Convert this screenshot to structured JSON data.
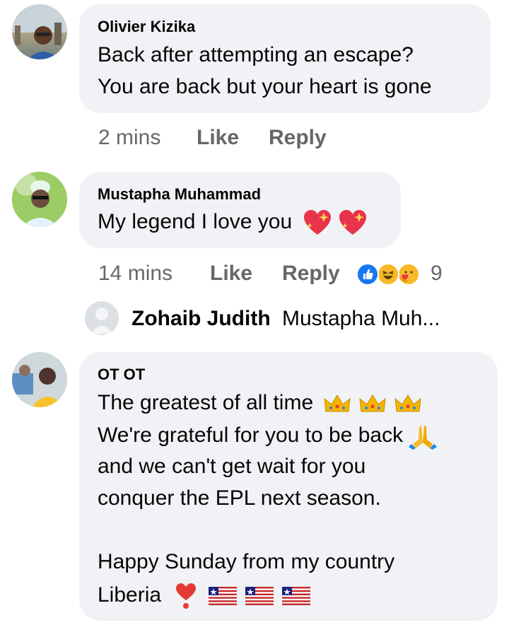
{
  "comments": [
    {
      "author": "Olivier Kizika",
      "lines": [
        "Back after attempting an escape?",
        "You are back but your heart is gone"
      ],
      "time": "2 mins",
      "like_label": "Like",
      "reply_label": "Reply"
    },
    {
      "author": "Mustapha Muhammad",
      "lines": [
        "My legend I love you"
      ],
      "time": "14 mins",
      "like_label": "Like",
      "reply_label": "Reply",
      "reaction_count": "9",
      "reactions": [
        "like-icon",
        "laughing-icon",
        "care-icon"
      ],
      "reply_preview": {
        "author": "Zohaib Judith",
        "text": "Mustapha Muh..."
      }
    },
    {
      "author": "OT OT",
      "lines": [
        "The greatest of all time",
        "We're grateful for you to be back",
        "and we can't get wait for you",
        "conquer the EPL next season.",
        "",
        "Happy Sunday from my country",
        "Liberia"
      ]
    }
  ],
  "colors": {
    "bubble": "#f0f2f5",
    "meta_text": "#65676b",
    "like_blue": "#1877f2",
    "emoji_yellow": "#f7b928"
  }
}
